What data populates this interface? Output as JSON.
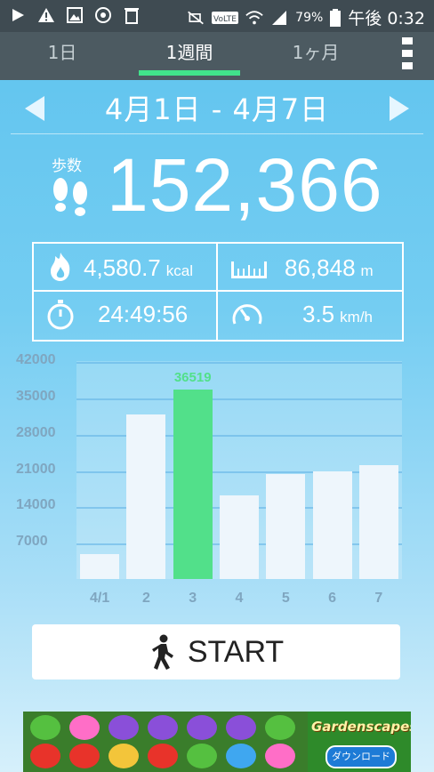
{
  "status_bar": {
    "battery_pct": "79%",
    "clock": "午後 0:32",
    "icons": [
      "play-icon",
      "warning-icon",
      "image-icon",
      "sync-icon",
      "recycle-icon",
      "mute-icon",
      "volte-icon",
      "wifi-icon",
      "signal-icon",
      "battery-icon"
    ],
    "volte_text": "VoLTE"
  },
  "tabs": [
    {
      "label": "1日",
      "active": false
    },
    {
      "label": "1週間",
      "active": true
    },
    {
      "label": "1ヶ月",
      "active": false
    }
  ],
  "range_label": "4月1日 - 4月7日",
  "steps": {
    "label": "歩数",
    "value": "152,366"
  },
  "stats": {
    "calories": {
      "value": "4,580.7",
      "unit": "kcal"
    },
    "distance": {
      "value": "86,848",
      "unit": "m"
    },
    "time": {
      "value": "24:49:56"
    },
    "speed": {
      "value": "3.5",
      "unit": "km/h"
    }
  },
  "chart_data": {
    "type": "bar",
    "categories": [
      "4/1",
      "2",
      "3",
      "4",
      "5",
      "6",
      "7"
    ],
    "values": [
      4800,
      31700,
      36519,
      16200,
      20300,
      20800,
      22000
    ],
    "highlight_index": 2,
    "highlight_label": "36519",
    "yticks": [
      "42000",
      "35000",
      "28000",
      "21000",
      "14000",
      "7000"
    ],
    "ytick_values": [
      42000,
      35000,
      28000,
      21000,
      14000,
      7000
    ],
    "ylim": [
      0,
      42000
    ],
    "colors": {
      "bar": "#eef6fc",
      "highlight": "#52e08a",
      "tick": "#7fa6c0"
    }
  },
  "start_button": {
    "label": "START"
  },
  "ad": {
    "brand": "Gardenscapes",
    "download": "ダウンロード"
  }
}
